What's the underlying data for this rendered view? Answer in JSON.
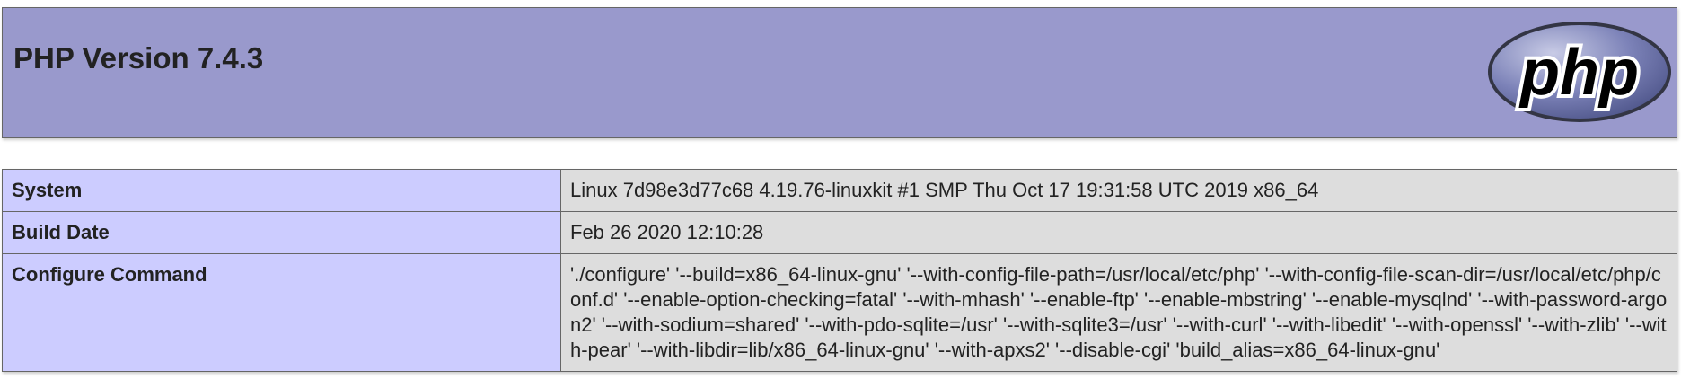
{
  "header": {
    "title": "PHP Version 7.4.3",
    "logo_text": "php"
  },
  "colors": {
    "header_bg": "#9999cc",
    "key_bg": "#ccccff",
    "value_bg": "#dddddd",
    "border": "#666666"
  },
  "rows": [
    {
      "key": "System",
      "value": "Linux 7d98e3d77c68 4.19.76-linuxkit #1 SMP Thu Oct 17 19:31:58 UTC 2019 x86_64"
    },
    {
      "key": "Build Date",
      "value": "Feb 26 2020 12:10:28"
    },
    {
      "key": "Configure Command",
      "value": "'./configure' '--build=x86_64-linux-gnu' '--with-config-file-path=/usr/local/etc/php' '--with-config-file-scan-dir=/usr/local/etc/php/conf.d' '--enable-option-checking=fatal' '--with-mhash' '--enable-ftp' '--enable-mbstring' '--enable-mysqlnd' '--with-password-argon2' '--with-sodium=shared' '--with-pdo-sqlite=/usr' '--with-sqlite3=/usr' '--with-curl' '--with-libedit' '--with-openssl' '--with-zlib' '--with-pear' '--with-libdir=lib/x86_64-linux-gnu' '--with-apxs2' '--disable-cgi' 'build_alias=x86_64-linux-gnu'"
    }
  ]
}
